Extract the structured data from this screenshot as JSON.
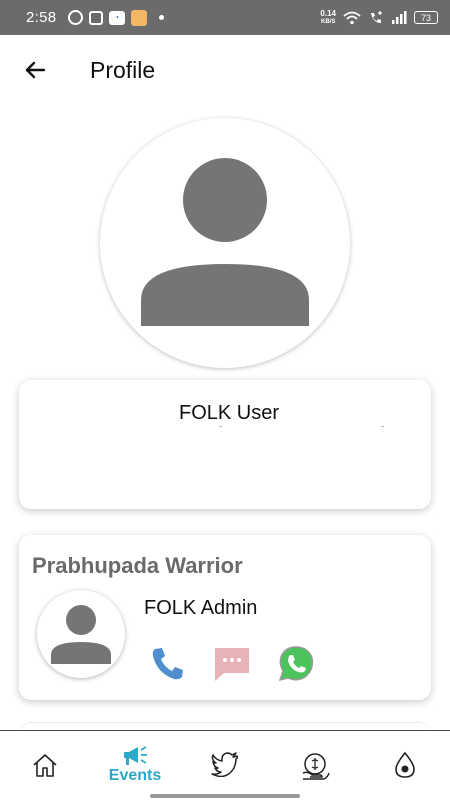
{
  "status_bar": {
    "time": "2:58",
    "net_speed_value": "0.14",
    "net_speed_unit": "KB/S",
    "battery": "73"
  },
  "header": {
    "title": "Profile"
  },
  "user_card": {
    "name": "FOLK User"
  },
  "admin_card": {
    "section_title": "Prabhupada Warrior",
    "admin_name": "FOLK Admin"
  },
  "bottom_nav": {
    "items": [
      {
        "label": "",
        "icon": "home-icon"
      },
      {
        "label": "Events",
        "icon": "megaphone-icon",
        "active": true
      },
      {
        "label": "",
        "icon": "twitter-icon"
      },
      {
        "label": "",
        "icon": "donation-icon"
      },
      {
        "label": "",
        "icon": "drop-icon"
      }
    ],
    "active_color": "#2aa9c9"
  },
  "colors": {
    "status_bar": "#6b6b6b",
    "avatar_gray": "#757575",
    "phone_blue": "#4f8fd0",
    "message_pink": "#e8b3b6",
    "whatsapp_green": "#4bc35b"
  }
}
